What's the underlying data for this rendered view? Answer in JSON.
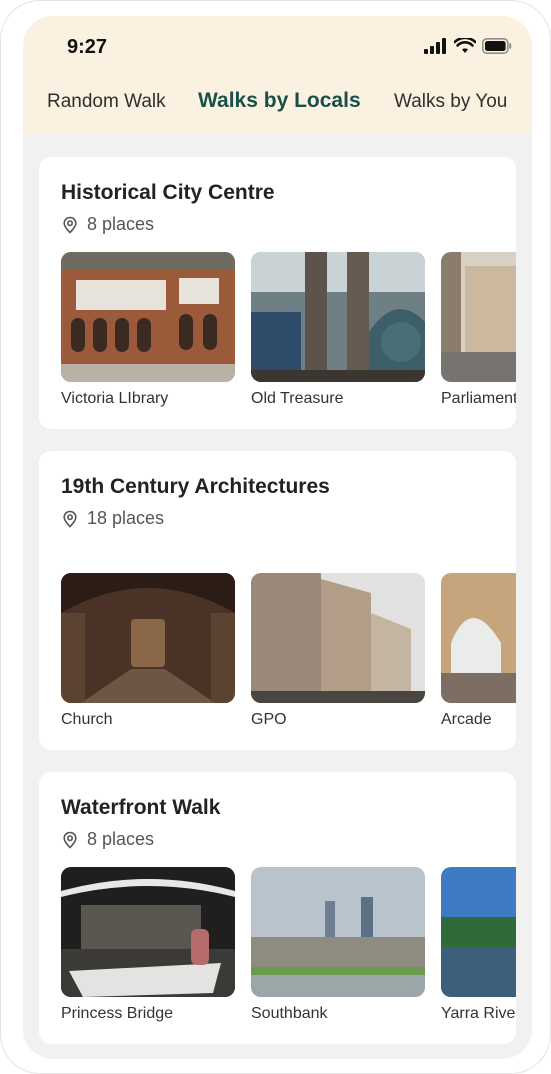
{
  "status": {
    "time": "9:27"
  },
  "tabs": [
    {
      "label": "Random Walk",
      "active": false
    },
    {
      "label": "Walks by Locals",
      "active": true
    },
    {
      "label": "Walks by You",
      "active": false
    }
  ],
  "walks": [
    {
      "title": "Historical City Centre",
      "count": "8 places",
      "places": [
        {
          "name": "Victoria LIbrary"
        },
        {
          "name": "Old Treasure"
        },
        {
          "name": "Parliament"
        }
      ]
    },
    {
      "title": "19th Century Architectures",
      "count": "18 places",
      "places": [
        {
          "name": "Church"
        },
        {
          "name": "GPO"
        },
        {
          "name": "Arcade"
        }
      ]
    },
    {
      "title": "Waterfront Walk",
      "count": "8 places",
      "places": [
        {
          "name": "Princess Bridge"
        },
        {
          "name": "Southbank"
        },
        {
          "name": "Yarra River"
        }
      ]
    }
  ],
  "colors": {
    "header_bg": "#fbf1e0",
    "active_tab": "#18504a",
    "screen_bg": "#f1f1f2"
  }
}
